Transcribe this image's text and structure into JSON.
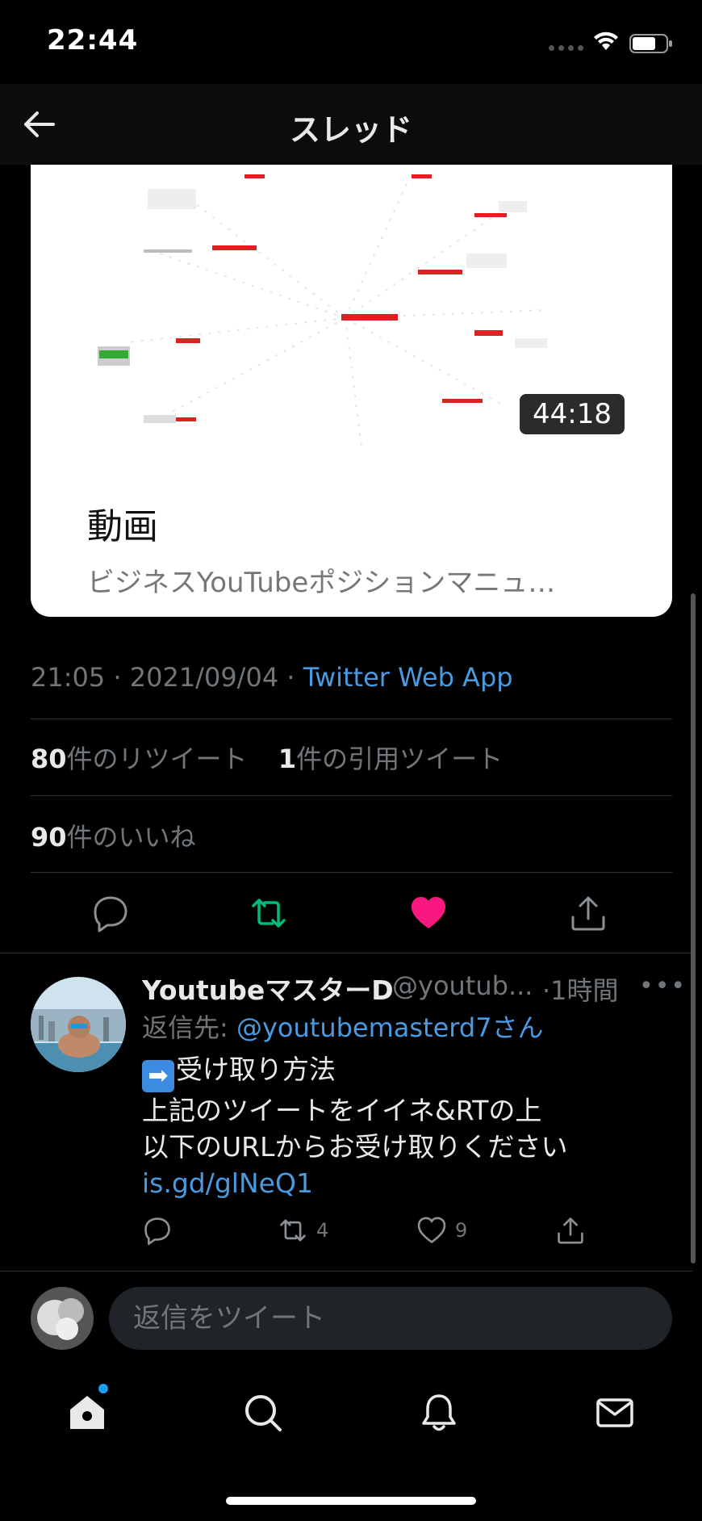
{
  "status_bar": {
    "time": "22:44"
  },
  "header": {
    "title": "スレッド"
  },
  "media_card": {
    "duration": "44:18",
    "title": "動画",
    "subtitle": "ビジネスYouTubeポジションマニュ…"
  },
  "tweet_meta": {
    "timestamp": "21:05 · 2021/09/04 · ",
    "source": "Twitter Web App"
  },
  "stats": {
    "retweets_count": "80",
    "retweets_label": "件のリツイート",
    "quotes_count": "1",
    "quotes_label": "件の引用ツイート",
    "likes_count": "90",
    "likes_label": "件のいいね"
  },
  "colors": {
    "retweet_active": "#00ba7c",
    "like_active": "#f91880",
    "link": "#4a9ae0"
  },
  "reply": {
    "name": "YoutubeマスターD",
    "handle": "@youtub...",
    "time": "·1時間",
    "more": "•••",
    "reply_to_label": "返信先: ",
    "reply_to_mention": "@youtubemasterd7さん",
    "emoji": "➡",
    "line1": "受け取り方法",
    "line2": "上記のツイートをイイネ&RTの上",
    "line3": "以下のURLからお受け取りください",
    "link": "is.gd/glNeQ1",
    "retweets": "4",
    "likes": "9"
  },
  "composer": {
    "placeholder": "返信をツイート"
  }
}
